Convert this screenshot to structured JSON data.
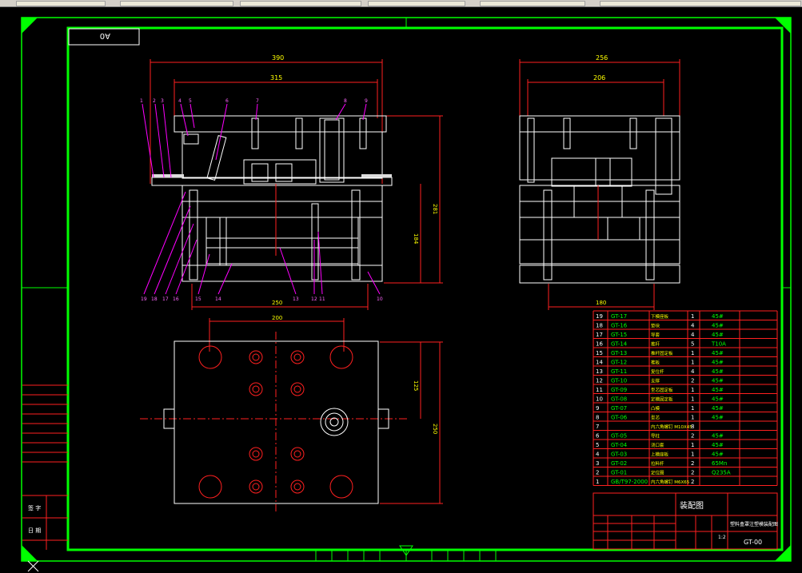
{
  "drawing": {
    "scale_label": "A0",
    "title_block": {
      "title": "装配图",
      "subtitle": "塑料盒罩注塑模装配图",
      "drawing_number": "GT-00",
      "scale": "1:2",
      "left_labels": [
        "签 字",
        "日 期"
      ]
    },
    "dimensions": {
      "front_width_outer": "390",
      "front_width_inner": "315",
      "front_height": "281",
      "front_inner_height": "184",
      "front_bottom": "250",
      "side_width_outer": "256",
      "side_width_inner": "206",
      "side_bottom": "180",
      "top_view_width": "200",
      "top_view_height": "250",
      "top_view_inner": "125"
    },
    "parts": [
      {
        "no": "19",
        "code": "GT-17",
        "name": "下模座板",
        "qty": "1",
        "material": "45#"
      },
      {
        "no": "18",
        "code": "GT-16",
        "name": "垫块",
        "qty": "4",
        "material": "45#"
      },
      {
        "no": "17",
        "code": "GT-15",
        "name": "导套",
        "qty": "4",
        "material": "45#"
      },
      {
        "no": "16",
        "code": "GT-14",
        "name": "推杆",
        "qty": "5",
        "material": "T10A"
      },
      {
        "no": "15",
        "code": "GT-13",
        "name": "推杆固定板",
        "qty": "1",
        "material": "45#"
      },
      {
        "no": "14",
        "code": "GT-12",
        "name": "推板",
        "qty": "1",
        "material": "45#"
      },
      {
        "no": "13",
        "code": "GT-11",
        "name": "复位杆",
        "qty": "4",
        "material": "45#"
      },
      {
        "no": "12",
        "code": "GT-10",
        "name": "支撑",
        "qty": "2",
        "material": "45#"
      },
      {
        "no": "11",
        "code": "GT-09",
        "name": "型芯固定板",
        "qty": "1",
        "material": "45#"
      },
      {
        "no": "10",
        "code": "GT-08",
        "name": "定模固定板",
        "qty": "1",
        "material": "45#"
      },
      {
        "no": "9",
        "code": "GT-07",
        "name": "凸模",
        "qty": "1",
        "material": "45#"
      },
      {
        "no": "8",
        "code": "GT-06",
        "name": "型芯",
        "qty": "1",
        "material": "45#"
      },
      {
        "no": "7",
        "code": "",
        "name": "内六角螺钉 M10X45",
        "qty": "8",
        "material": ""
      },
      {
        "no": "6",
        "code": "GT-05",
        "name": "导柱",
        "qty": "2",
        "material": "45#"
      },
      {
        "no": "5",
        "code": "GT-04",
        "name": "浇口套",
        "qty": "1",
        "material": "45#"
      },
      {
        "no": "4",
        "code": "GT-03",
        "name": "上模座板",
        "qty": "1",
        "material": "45#"
      },
      {
        "no": "3",
        "code": "GT-02",
        "name": "拉料杆",
        "qty": "2",
        "material": "65Mn"
      },
      {
        "no": "2",
        "code": "GT-01",
        "name": "定位圈",
        "qty": "2",
        "material": "Q235A"
      },
      {
        "no": "1",
        "code": "GB/T97-2000",
        "name": "内六角螺钉 M6X65",
        "qty": "2",
        "material": ""
      }
    ],
    "front_balloons_top": [
      "1",
      "2",
      "3",
      "4",
      "5",
      "6",
      "7",
      "8",
      "9"
    ],
    "front_balloons_bottom": [
      "19",
      "18",
      "17",
      "16",
      "15",
      "14",
      "13",
      "12",
      "11",
      "10"
    ]
  }
}
